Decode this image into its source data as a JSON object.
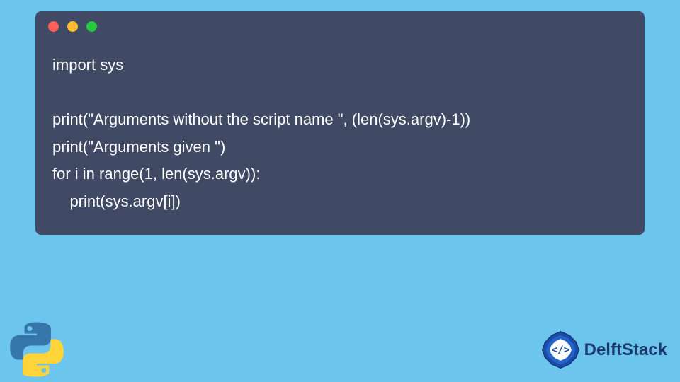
{
  "code": {
    "lines": [
      "import sys",
      "",
      "print(\"Arguments without the script name \", (len(sys.argv)-1))",
      "print(\"Arguments given \")",
      "for i in range(1, len(sys.argv)):",
      "    print(sys.argv[i])"
    ]
  },
  "branding": {
    "name": "DelftStack"
  },
  "colors": {
    "background": "#6bc5ed",
    "code_window": "#404a65",
    "dot_red": "#ff5f56",
    "dot_yellow": "#ffbd2e",
    "dot_green": "#27c93f",
    "brand_text": "#1a3a6e"
  }
}
